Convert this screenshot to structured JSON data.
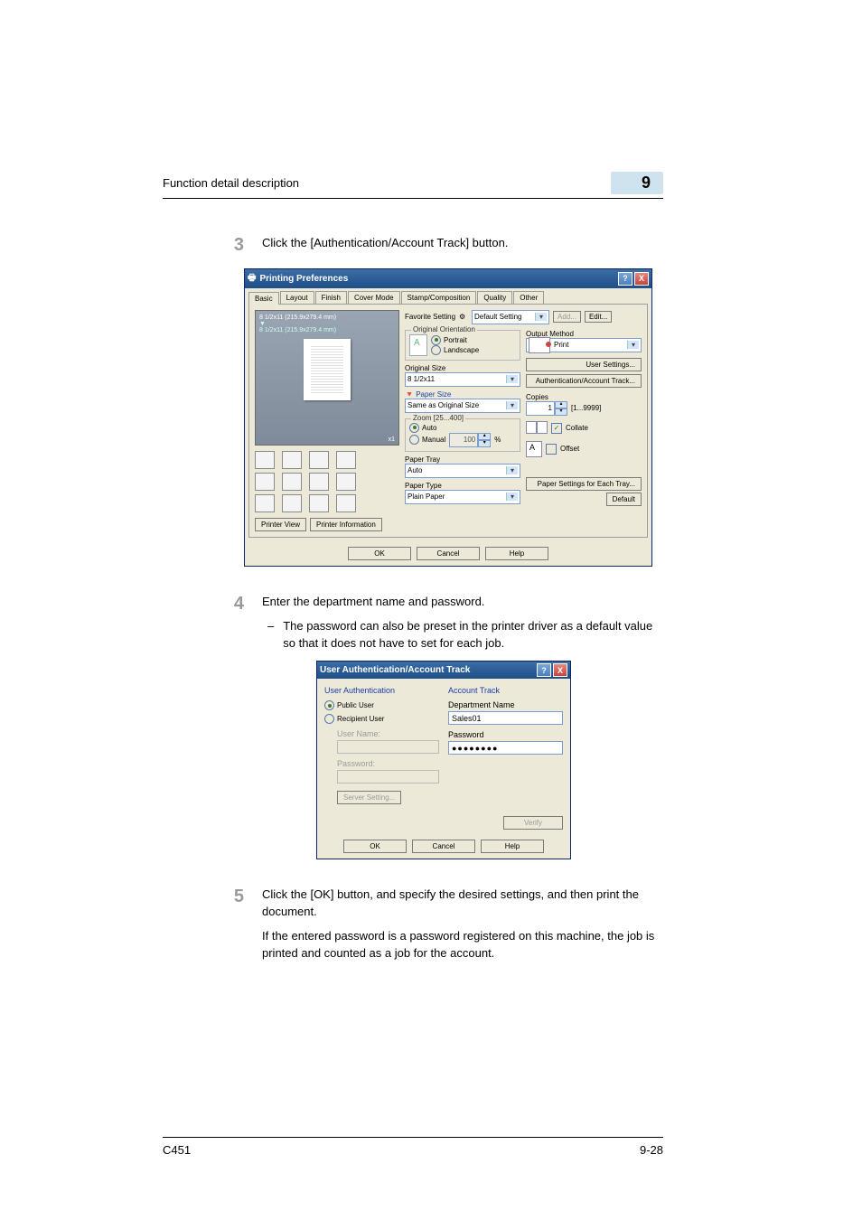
{
  "header": {
    "title": "Function detail description",
    "chapter": "9"
  },
  "step3": {
    "num": "3",
    "text": "Click the [Authentication/Account Track] button."
  },
  "dlg1": {
    "title": "Printing Preferences",
    "tabs": {
      "basic": "Basic",
      "layout": "Layout",
      "finish": "Finish",
      "cover": "Cover Mode",
      "stamp": "Stamp/Composition",
      "quality": "Quality",
      "other": "Other"
    },
    "preview": {
      "p1": "8 1/2x11 (215.9x279.4 mm)",
      "p2": "8 1/2x11 (215.9x279.4 mm)",
      "zoom": "x1"
    },
    "printerview": "Printer View",
    "printerinfo": "Printer Information",
    "fav": {
      "label": "Favorite Setting",
      "value": "Default Setting",
      "add": "Add...",
      "edit": "Edit..."
    },
    "orient": {
      "group": "Original Orientation",
      "portrait": "Portrait",
      "landscape": "Landscape"
    },
    "orig": {
      "label": "Original Size",
      "value": "8 1/2x11"
    },
    "paper": {
      "label": "Paper Size",
      "value": "Same as Original Size"
    },
    "zoom": {
      "group": "Zoom [25...400]",
      "auto": "Auto",
      "manual": "Manual",
      "value": "100",
      "pct": "%"
    },
    "tray": {
      "label": "Paper Tray",
      "value": "Auto"
    },
    "ptype": {
      "label": "Paper Type",
      "value": "Plain Paper"
    },
    "out": {
      "label": "Output Method",
      "value": "Print"
    },
    "usersettings": "User Settings...",
    "authbtn": "Authentication/Account Track...",
    "copies": {
      "label": "Copies",
      "value": "1",
      "range": "[1...9999]"
    },
    "collate": "Collate",
    "offset": "Offset",
    "eachtray": "Paper Settings for Each Tray...",
    "default": "Default",
    "ok": "OK",
    "cancel": "Cancel",
    "help": "Help"
  },
  "step4": {
    "num": "4",
    "text": "Enter the department name and password.",
    "bullet": "The password can also be preset in the printer driver as a default value so that it does not have to set for each job."
  },
  "dlg2": {
    "title": "User Authentication/Account Track",
    "ua": {
      "h": "User Authentication",
      "public": "Public User",
      "recipient": "Recipient User",
      "uname": "User Name:",
      "pw": "Password:",
      "server": "Server Setting..."
    },
    "at": {
      "h": "Account Track",
      "dept": "Department Name",
      "deptval": "Sales01",
      "pw": "Password",
      "pwval": "●●●●●●●●"
    },
    "verify": "Verify",
    "ok": "OK",
    "cancel": "Cancel",
    "help": "Help"
  },
  "step5": {
    "num": "5",
    "p1": "Click the [OK] button, and specify the desired settings, and then print the document.",
    "p2": "If the entered password is a password registered on this machine, the job is printed and counted as a job for the account."
  },
  "footer": {
    "model": "C451",
    "page": "9-28"
  }
}
